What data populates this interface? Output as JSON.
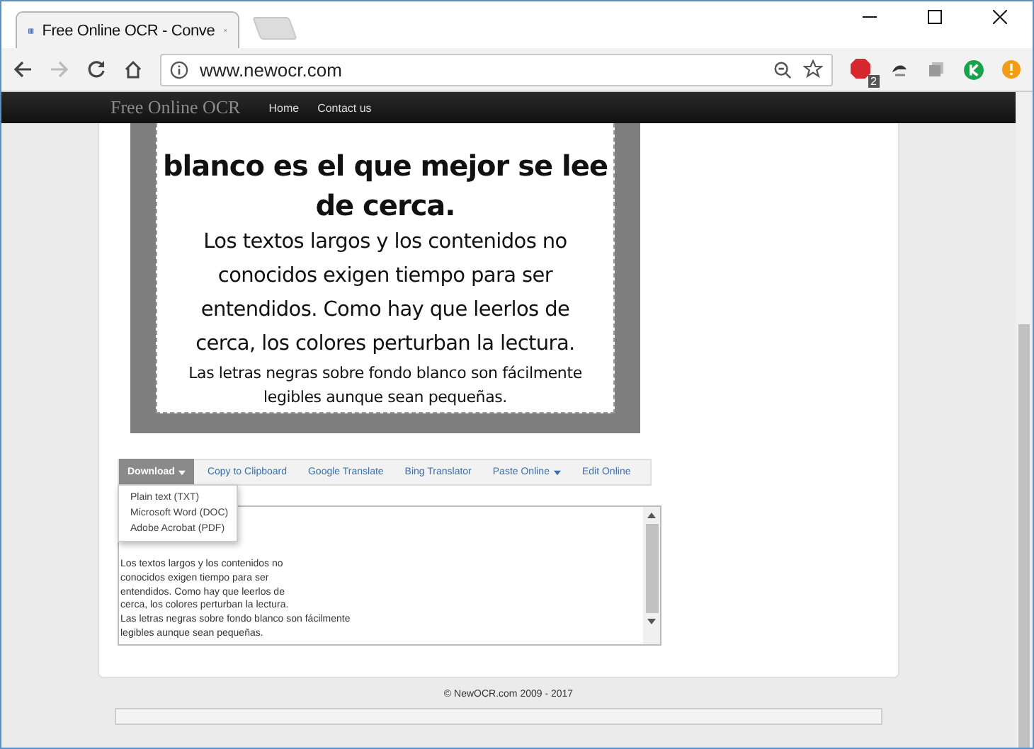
{
  "browser": {
    "tab_title": "Free Online OCR - Conve",
    "url": "www.newocr.com",
    "extension_badge": "2"
  },
  "site_nav": {
    "brand": "Free Online OCR",
    "links": [
      "Home",
      "Contact us"
    ]
  },
  "image_text": {
    "heading": [
      "blanco es el que mejor se lee",
      "de cerca."
    ],
    "paragraph": [
      "Los textos largos y los contenidos no",
      "conocidos exigen tiempo para ser",
      "entendidos. Como hay que leerlos de",
      "cerca, los colores perturban la lectura."
    ],
    "small": [
      "Las letras negras sobre fondo blanco son fácilmente",
      "legibles aunque sean pequeñas."
    ]
  },
  "actions": [
    {
      "label": "Download",
      "dropdown": true,
      "selected": true
    },
    {
      "label": "Copy to Clipboard",
      "dropdown": false,
      "selected": false
    },
    {
      "label": "Google Translate",
      "dropdown": false,
      "selected": false
    },
    {
      "label": "Bing Translator",
      "dropdown": false,
      "selected": false
    },
    {
      "label": "Paste Online",
      "dropdown": true,
      "selected": false
    },
    {
      "label": "Edit Online",
      "dropdown": false,
      "selected": false
    }
  ],
  "download_menu": [
    "Plain text (TXT)",
    "Microsoft Word (DOC)",
    "Adobe Acrobat (PDF)"
  ],
  "result_lines": [
    "Los textos largos y los contenidos no",
    "conocidos exigen tiempo para ser",
    "entendidos. Como hay que leerlos de",
    "cerca, los colores perturban la lectura.",
    "Las letras negras sobre fondo blanco son fácilmente",
    "legibles aunque sean pequeñas."
  ],
  "footer": "© NewOCR.com 2009 - 2017"
}
